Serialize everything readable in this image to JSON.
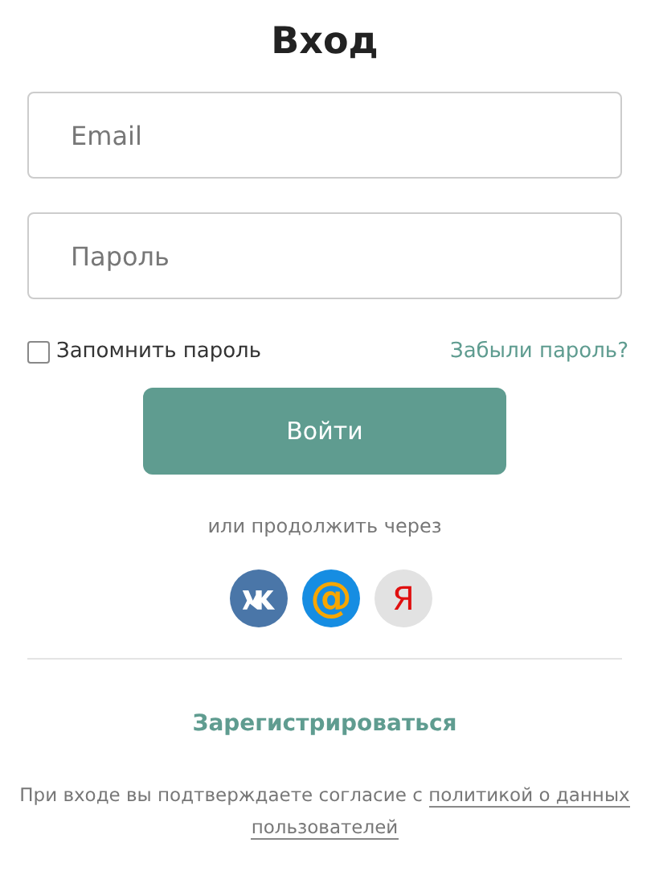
{
  "title": "Вход",
  "fields": [
    {
      "placeholder": "Email"
    },
    {
      "placeholder": "Пароль"
    }
  ],
  "remember": {
    "label": "Запомнить пароль",
    "checked": false
  },
  "forgot_link": "Забыли пароль?",
  "submit_button": "Войти",
  "alt_login_label": "или продолжить через",
  "socials": [
    {
      "kind": "vk"
    },
    {
      "kind": "mail",
      "glyph": "@"
    },
    {
      "kind": "yandex",
      "glyph": "Я"
    }
  ],
  "register_link": "Зарегистрироваться",
  "consent": {
    "text": "При входе вы подтверждаете согласие с ",
    "link_lines": [
      "политикой о данных",
      "пользователей"
    ]
  }
}
